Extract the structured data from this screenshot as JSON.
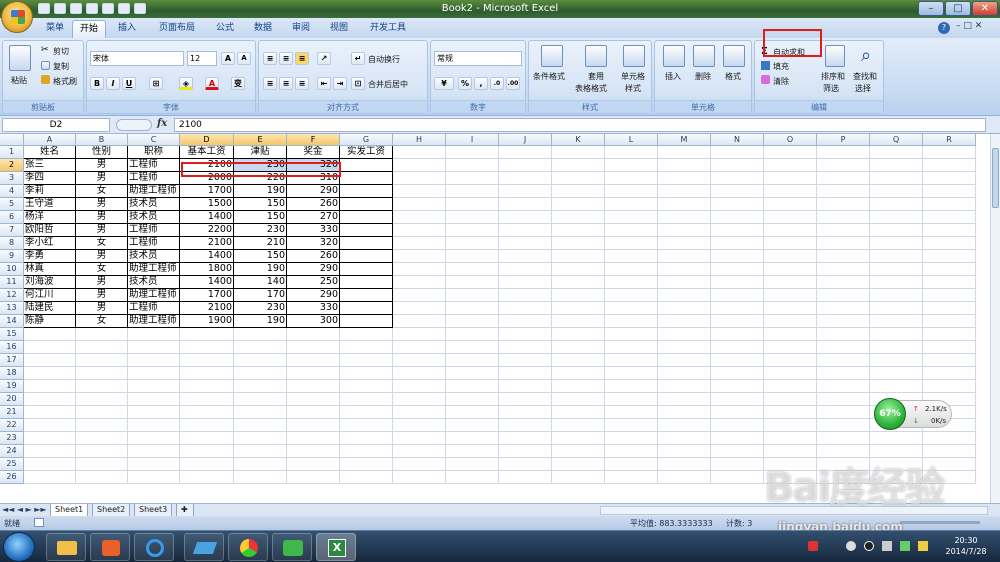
{
  "window": {
    "title": "Book2 - Microsoft Excel"
  },
  "tabs": [
    {
      "label": "菜单"
    },
    {
      "label": "开始"
    },
    {
      "label": "插入"
    },
    {
      "label": "页面布局"
    },
    {
      "label": "公式"
    },
    {
      "label": "数据"
    },
    {
      "label": "审阅"
    },
    {
      "label": "视图"
    },
    {
      "label": "开发工具"
    }
  ],
  "ribbon": {
    "clipboard": {
      "label": "剪贴板",
      "paste": "粘贴",
      "cut": "剪切",
      "copy": "复制",
      "format_painter": "格式刷"
    },
    "font": {
      "label": "字体",
      "font_name": "宋体",
      "font_size": "12"
    },
    "alignment": {
      "label": "对齐方式",
      "wrap": "自动换行",
      "merge": "合并后居中"
    },
    "number": {
      "label": "数字",
      "format": "常规"
    },
    "styles": {
      "label": "样式",
      "conditional": "条件格式",
      "table_1": "套用",
      "table_2": "表格格式",
      "cell_1": "单元格",
      "cell_2": "样式"
    },
    "cells": {
      "label": "单元格",
      "insert": "插入",
      "delete": "删除",
      "format": "格式"
    },
    "editing": {
      "label": "编辑",
      "autosum": "自动求和",
      "fill": "填充",
      "clear": "清除",
      "sort_1": "排序和",
      "sort_2": "筛选",
      "find_1": "查找和",
      "find_2": "选择"
    }
  },
  "formula_bar": {
    "name_box": "D2",
    "fx": "fx",
    "value": "2100"
  },
  "sheet": {
    "columns": [
      "A",
      "B",
      "C",
      "D",
      "E",
      "F",
      "G",
      "H",
      "I",
      "J",
      "K",
      "L",
      "M",
      "N",
      "O",
      "P",
      "Q",
      "R"
    ],
    "rows": [
      [
        "姓名",
        "性别",
        "职称",
        "基本工资",
        "津贴",
        "奖金",
        "实发工资"
      ],
      [
        "张三",
        "男",
        "工程师",
        "2100",
        "230",
        "320",
        ""
      ],
      [
        "李四",
        "男",
        "工程师",
        "2000",
        "220",
        "310",
        ""
      ],
      [
        "李莉",
        "女",
        "助理工程师",
        "1700",
        "190",
        "290",
        ""
      ],
      [
        "王守道",
        "男",
        "技术员",
        "1500",
        "150",
        "260",
        ""
      ],
      [
        "杨洋",
        "男",
        "技术员",
        "1400",
        "150",
        "270",
        ""
      ],
      [
        "欧阳哲",
        "男",
        "工程师",
        "2200",
        "230",
        "330",
        ""
      ],
      [
        "李小红",
        "女",
        "工程师",
        "2100",
        "210",
        "320",
        ""
      ],
      [
        "李勇",
        "男",
        "技术员",
        "1400",
        "150",
        "260",
        ""
      ],
      [
        "林真",
        "女",
        "助理工程师",
        "1800",
        "190",
        "290",
        ""
      ],
      [
        "刘海波",
        "男",
        "技术员",
        "1400",
        "140",
        "250",
        ""
      ],
      [
        "何江川",
        "男",
        "助理工程师",
        "1700",
        "170",
        "290",
        ""
      ],
      [
        "陆建民",
        "男",
        "工程师",
        "2100",
        "230",
        "330",
        ""
      ],
      [
        "陈静",
        "女",
        "助理工程师",
        "1900",
        "190",
        "300",
        ""
      ]
    ],
    "row_count": 26
  },
  "sheet_tabs": [
    "Sheet1",
    "Sheet2",
    "Sheet3"
  ],
  "status": {
    "ready": "就绪",
    "average": "平均值: 883.3333333",
    "count": "计数: 3"
  },
  "network": {
    "percent": "67%",
    "up": "2.1K/s",
    "down": "0K/s"
  },
  "clock": {
    "time": "20:30",
    "date": "2014/7/28"
  },
  "watermark": {
    "logo": "Bai度经验",
    "url": "jingyan.baidu.com"
  }
}
